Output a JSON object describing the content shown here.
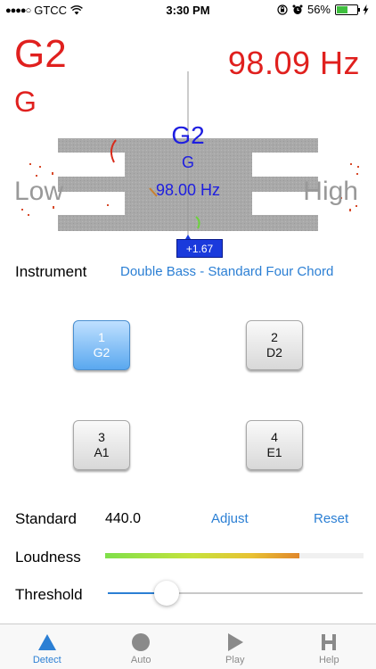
{
  "status": {
    "carrier": "GTCC",
    "time": "3:30 PM",
    "battery": "56%",
    "battery_level": 0.56
  },
  "readout": {
    "note": "G2",
    "note_name": "G",
    "frequency": "98.09 Hz"
  },
  "tuner": {
    "low_label": "Low",
    "high_label": "High",
    "target_note": "G2",
    "target_name": "G",
    "target_frequency": "98.00 Hz",
    "cents": "+1.67"
  },
  "instrument": {
    "label": "Instrument",
    "value": "Double Bass - Standard Four Chord"
  },
  "strings": [
    {
      "number": "1",
      "note": "G2",
      "active": true
    },
    {
      "number": "2",
      "note": "D2",
      "active": false
    },
    {
      "number": "3",
      "note": "A1",
      "active": false
    },
    {
      "number": "4",
      "note": "E1",
      "active": false
    }
  ],
  "standard": {
    "label": "Standard",
    "value": "440.0",
    "adjust": "Adjust",
    "reset": "Reset"
  },
  "loudness": {
    "label": "Loudness",
    "level": 0.75
  },
  "threshold": {
    "label": "Threshold",
    "level": 0.23
  },
  "tabs": [
    {
      "label": "Detect",
      "icon": "triangle-icon",
      "active": true
    },
    {
      "label": "Auto",
      "icon": "circle-icon",
      "active": false
    },
    {
      "label": "Play",
      "icon": "play-icon",
      "active": false
    },
    {
      "label": "Help",
      "icon": "help-h-icon",
      "active": false
    }
  ],
  "colors": {
    "note_red": "#e0201e",
    "target_blue": "#1e1ee0",
    "link_blue": "#2b7fd4"
  }
}
